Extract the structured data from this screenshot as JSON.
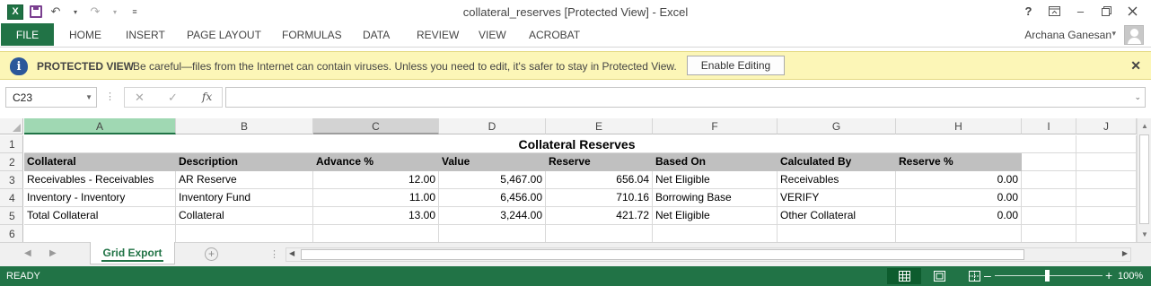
{
  "window": {
    "title": "collateral_reserves  [Protected View] - Excel",
    "app_icon": "X",
    "undo_glyph": "↶",
    "redo_glyph": "↷",
    "help": "?",
    "minimize": "–"
  },
  "ribbon": {
    "file": "FILE",
    "tabs": [
      "HOME",
      "INSERT",
      "PAGE LAYOUT",
      "FORMULAS",
      "DATA",
      "REVIEW",
      "VIEW",
      "ACROBAT"
    ],
    "user": "Archana Ganesan"
  },
  "protected_view": {
    "icon": "i",
    "title": "PROTECTED VIEW",
    "message": "Be careful—files from the Internet can contain viruses. Unless you need to edit, it's safer to stay in Protected View.",
    "button": "Enable Editing",
    "close": "✕"
  },
  "formula_bar": {
    "name_box": "C23",
    "fx": "fx",
    "cancel": "✕",
    "enter": "✓",
    "value": ""
  },
  "grid": {
    "columns": [
      "A",
      "B",
      "C",
      "D",
      "E",
      "F",
      "G",
      "H",
      "I",
      "J"
    ],
    "rows": [
      "1",
      "2",
      "3",
      "4",
      "5",
      "6"
    ],
    "title": "Collateral Reserves",
    "headers": [
      "Collateral",
      "Description",
      "Advance %",
      "Value",
      "Reserve",
      "Based On",
      "Calculated By",
      "Reserve %"
    ],
    "data": [
      [
        "Receivables - Receivables",
        "AR Reserve",
        "12.00",
        "5,467.00",
        "656.04",
        "Net Eligible",
        "Receivables",
        "0.00"
      ],
      [
        "Inventory - Inventory",
        "Inventory Fund",
        "11.00",
        "6,456.00",
        "710.16",
        "Borrowing Base",
        "VERIFY",
        "0.00"
      ],
      [
        "Total Collateral",
        "Collateral",
        "13.00",
        "3,244.00",
        "421.72",
        "Net Eligible",
        "Other Collateral",
        "0.00"
      ]
    ]
  },
  "sheets": {
    "active": "Grid Export",
    "add": "+"
  },
  "status": {
    "text": "READY",
    "zoom": "100%",
    "zoom_minus": "–",
    "zoom_plus": "+",
    "zoom_level_pct": 100
  },
  "colors": {
    "accent": "#217346",
    "protected_bar": "#fcf6b7",
    "header_fill": "#c0c0c0"
  }
}
